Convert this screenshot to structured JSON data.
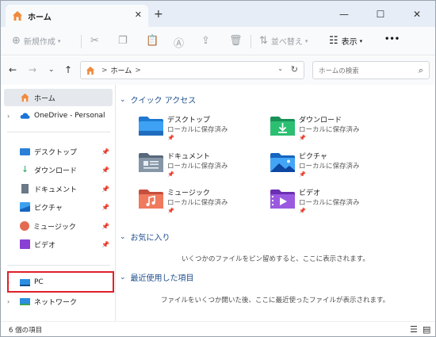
{
  "tab": {
    "title": "ホーム",
    "close": "✕",
    "new": "+"
  },
  "window_buttons": {
    "minimize": "—",
    "maximize": "☐",
    "close": "✕"
  },
  "commandbar": {
    "new_label": "新規作成",
    "sort_label": "並べ替え",
    "view_label": "表示",
    "more": "•••"
  },
  "address": {
    "crumb": "ホーム",
    "sep": ">",
    "search_placeholder": "ホームの検索"
  },
  "navpane": {
    "home": "ホーム",
    "onedrive": "OneDrive - Personal",
    "quick": [
      {
        "label": "デスクトップ",
        "icon": "desktop-icon"
      },
      {
        "label": "ダウンロード",
        "icon": "download-icon"
      },
      {
        "label": "ドキュメント",
        "icon": "document-icon"
      },
      {
        "label": "ピクチャ",
        "icon": "pictures-icon"
      },
      {
        "label": "ミュージック",
        "icon": "music-icon"
      },
      {
        "label": "ビデオ",
        "icon": "video-icon"
      }
    ],
    "pc": "PC",
    "network": "ネットワーク"
  },
  "sections": {
    "quick_access": "クイック アクセス",
    "favorites": "お気に入り",
    "recent": "最近使用した項目"
  },
  "folders": [
    {
      "name": "デスクトップ",
      "sub": "ローカルに保存済み"
    },
    {
      "name": "ダウンロード",
      "sub": "ローカルに保存済み"
    },
    {
      "name": "ドキュメント",
      "sub": "ローカルに保存済み"
    },
    {
      "name": "ピクチャ",
      "sub": "ローカルに保存済み"
    },
    {
      "name": "ミュージック",
      "sub": "ローカルに保存済み"
    },
    {
      "name": "ビデオ",
      "sub": "ローカルに保存済み"
    }
  ],
  "messages": {
    "favorites_empty": "いくつかのファイルをピン留めすると、ここに表示されます。",
    "recent_empty": "ファイルをいくつか開いた後、ここに最近使ったファイルが表示されます。"
  },
  "status": {
    "count": "6 個の項目"
  },
  "colors": {
    "highlight": "#e0202a",
    "accent": "#1e4e8c",
    "selected": "#e5e8ec"
  }
}
